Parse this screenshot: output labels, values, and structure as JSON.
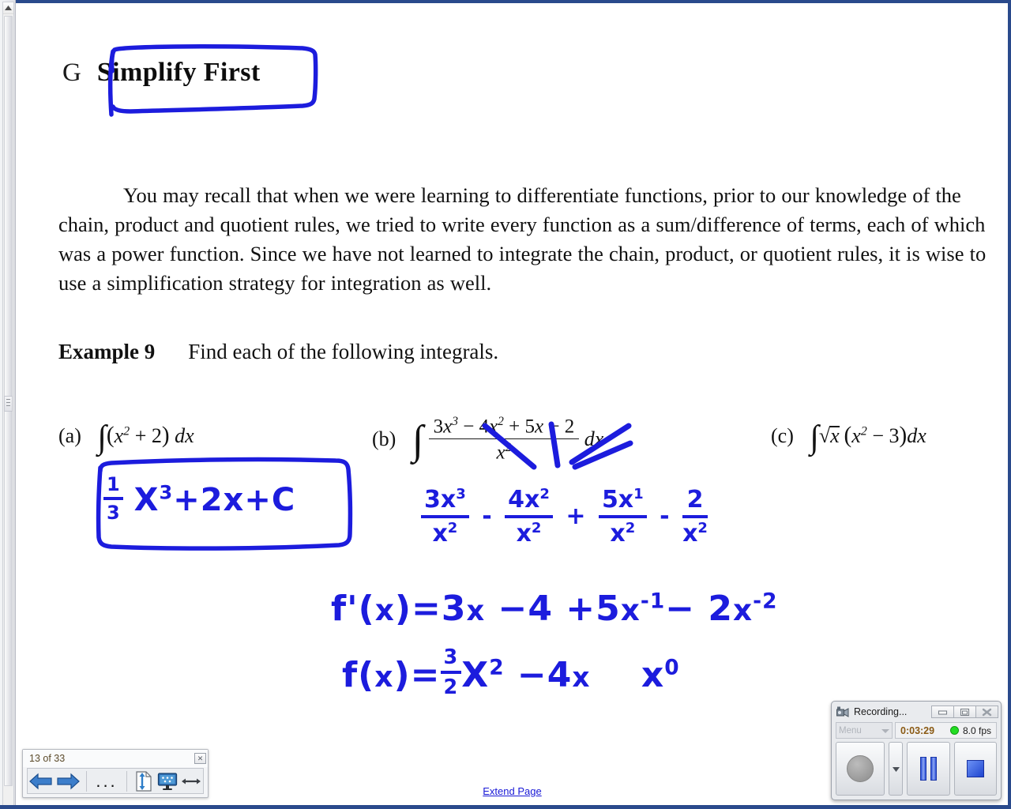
{
  "document": {
    "heading": {
      "letter": "G",
      "title": "Simplify First"
    },
    "paragraph": "You may recall that when we were learning to differentiate functions, prior to our knowledge of the chain, product and quotient rules, we tried to write every function as a sum/difference of terms, each of which was a power function.  Since we have not learned to integrate the chain, product, or quotient rules, it is wise to use a simplification strategy for integration as well.",
    "example": {
      "label": "Example 9",
      "text": "Find each of the following integrals."
    },
    "problems": [
      {
        "label": "(a)",
        "expression": "∫(x² + 2) dx"
      },
      {
        "label": "(b)",
        "numerator": "3x³ − 4x² + 5x − 2",
        "denominator": "x²",
        "expression": "∫ (3x³ − 4x² + 5x − 2)/x² dx"
      },
      {
        "label": "(c)",
        "expression": "∫√x (x² − 3) dx"
      }
    ],
    "ink_annotations": {
      "color": "#1c1cdd",
      "answer_a": "1/3 x³ + 2x + C",
      "work_b_line1": "3x³/x² − 4x²/x² + 5x¹/x² − 2/x²",
      "work_b_line2": "f'(x)=3x − 4 + 5x⁻¹ − 2x⁻²",
      "work_b_line3": "f(x) = 3/2 x² − 4x",
      "work_b_note": "x⁰"
    },
    "extend_page_link": "Extend Page"
  },
  "nav_widget": {
    "page_counter": "13 of 33",
    "close_label": "✕",
    "buttons": [
      {
        "name": "previous-page",
        "label": "◀"
      },
      {
        "name": "next-page",
        "label": "▶"
      },
      {
        "name": "more-options",
        "label": "..."
      },
      {
        "name": "fit-page-height",
        "label": ""
      },
      {
        "name": "presentation-screen",
        "label": ""
      },
      {
        "name": "fit-page-width",
        "label": ""
      }
    ]
  },
  "recorder": {
    "title": "Recording...",
    "menu_label": "Menu",
    "elapsed_time": "0:03:29",
    "fps": "8.0 fps",
    "status_color": "#22dd22",
    "window_buttons": {
      "minimize": "minimize-icon",
      "restore": "restore-icon",
      "close": "close-icon"
    },
    "controls": {
      "record": "record-button",
      "record_dropdown": "▾",
      "pause": "pause-button",
      "stop": "stop-button"
    }
  },
  "colors": {
    "ink_blue": "#1c1cdd",
    "link_blue": "#1818d6",
    "window_frame": "#2a4a8c",
    "page_counter_text": "#5b4a2a",
    "timer_text": "#8a5a14"
  }
}
